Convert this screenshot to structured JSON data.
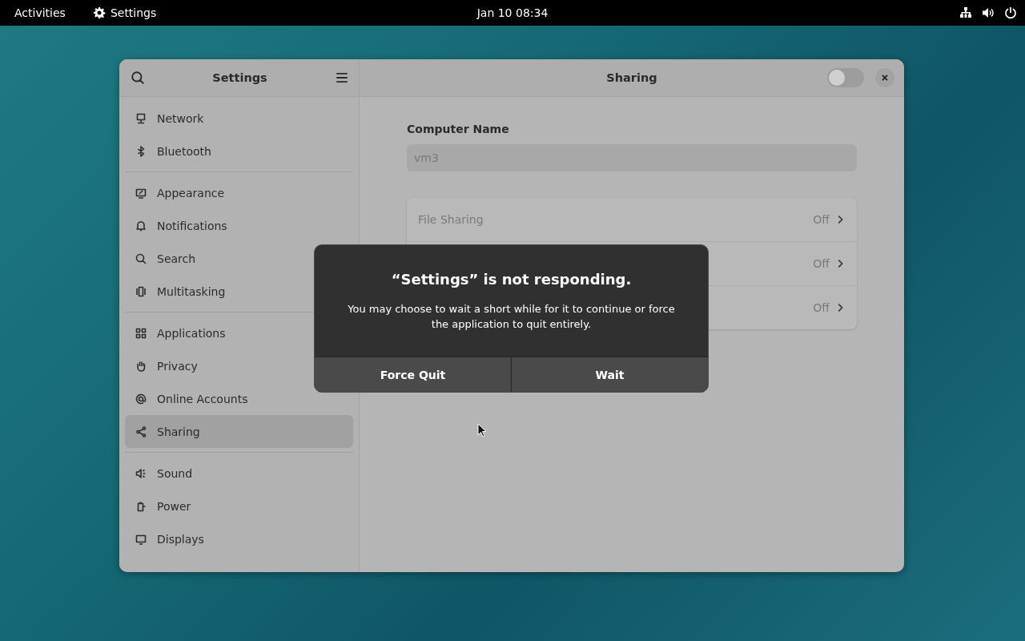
{
  "top_bar": {
    "activities": "Activities",
    "app_name": "Settings",
    "clock": "Jan 10  08:34"
  },
  "window": {
    "sidebar": {
      "title": "Settings",
      "groups": [
        [
          {
            "label": "Network",
            "selected": false
          },
          {
            "label": "Bluetooth",
            "selected": false
          }
        ],
        [
          {
            "label": "Appearance",
            "selected": false
          },
          {
            "label": "Notifications",
            "selected": false
          },
          {
            "label": "Search",
            "selected": false
          },
          {
            "label": "Multitasking",
            "selected": false
          }
        ],
        [
          {
            "label": "Applications",
            "selected": false
          },
          {
            "label": "Privacy",
            "selected": false
          },
          {
            "label": "Online Accounts",
            "selected": false
          },
          {
            "label": "Sharing",
            "selected": true
          }
        ],
        [
          {
            "label": "Sound",
            "selected": false
          },
          {
            "label": "Power",
            "selected": false
          },
          {
            "label": "Displays",
            "selected": false
          }
        ]
      ]
    },
    "content": {
      "title": "Sharing",
      "master_switch": {
        "on": false
      },
      "computer_name_label": "Computer Name",
      "computer_name": "vm3",
      "rows": [
        {
          "label": "File Sharing",
          "status": "Off"
        },
        {
          "status": "Off"
        },
        {
          "status": "Off"
        }
      ]
    }
  },
  "dialog": {
    "title": "“Settings” is not responding.",
    "message": "You may choose to wait a short while for it to continue or force the application to quit entirely.",
    "buttons": [
      "Force Quit",
      "Wait"
    ]
  }
}
